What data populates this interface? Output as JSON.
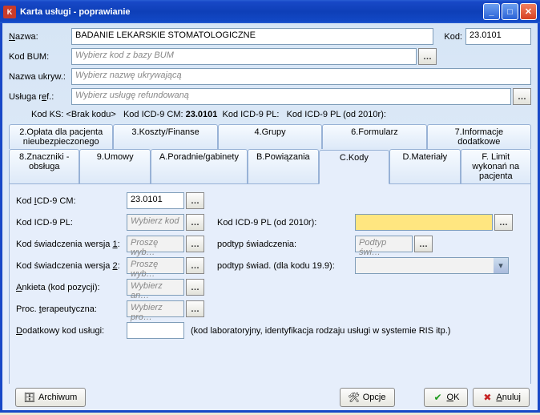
{
  "window": {
    "title": "Karta usługi - poprawianie"
  },
  "header": {
    "nazwa_lbl": "Nazwa:",
    "nazwa_val": "BADANIE LEKARSKIE STOMATOLOGICZNE",
    "kod_lbl": "Kod:",
    "kod_val": "23.0101",
    "kodbum_lbl": "Kod BUM:",
    "kodbum_ph": "Wybierz kod z bazy BUM",
    "nazwaukryw_lbl": "Nazwa ukryw.:",
    "nazwaukryw_ph": "Wybierz nazwę ukrywającą",
    "uslugaref_lbl": "Usługa ref.:",
    "uslugaref_ph": "Wybierz usługę refundowaną"
  },
  "inforow": {
    "kodks_lbl": "Kod KS:",
    "kodks_val": "<Brak kodu>",
    "icd9cm_lbl": "Kod ICD-9 CM:",
    "icd9cm_val": "23.0101",
    "icd9pl_lbl": "Kod ICD-9 PL:",
    "icd9pl2010_lbl": "Kod ICD-9 PL (od 2010r):"
  },
  "tabs1": {
    "t2": "2.Opłata dla pacjenta nieubezpieczonego",
    "t3": "3.Koszty/Finanse",
    "t4": "4.Grupy",
    "t6": "6.Formularz",
    "t7": "7.Informacje dodatkowe"
  },
  "tabs2": {
    "t8": "8.Znaczniki - obsługa",
    "t9": "9.Umowy",
    "tA": "A.Poradnie/gabinety",
    "tB": "B.Powiązania",
    "tC": "C.Kody",
    "tD": "D.Materiały",
    "tF": "F. Limit wykonań na pacjenta"
  },
  "panel": {
    "icd9cm_lbl": "Kod ICD-9 CM:",
    "icd9cm_val": "23.0101",
    "icd9pl_lbl": "Kod ICD-9 PL:",
    "icd9pl_ph": "Wybierz kod",
    "icd9pl2010_lbl": "Kod ICD-9 PL (od 2010r):",
    "ksw1_lbl": "Kod świadczenia wersja 1:",
    "ksw_ph": "Proszę wyb…",
    "podtyp_lbl": "podtyp świadczenia:",
    "podtyp_ph": "Podtyp świ…",
    "ksw2_lbl": "Kod świadczenia wersja 2:",
    "podtyp199_lbl": "podtyp świad. (dla kodu 19.9):",
    "ankieta_lbl": "Ankieta (kod pozycji):",
    "ankieta_ph": "Wybierz an…",
    "proc_lbl": "Proc. terapeutyczna:",
    "proc_ph": "Wybierz pro…",
    "dodkod_lbl": "Dodatkowy kod usługi:",
    "dodkod_note": "(kod laboratoryjny, identyfikacja rodzaju usługi w systemie RIS itp.)"
  },
  "footer": {
    "archiwum": "Archiwum",
    "opcje": "Opcje",
    "ok": "OK",
    "anuluj": "Anuluj"
  }
}
